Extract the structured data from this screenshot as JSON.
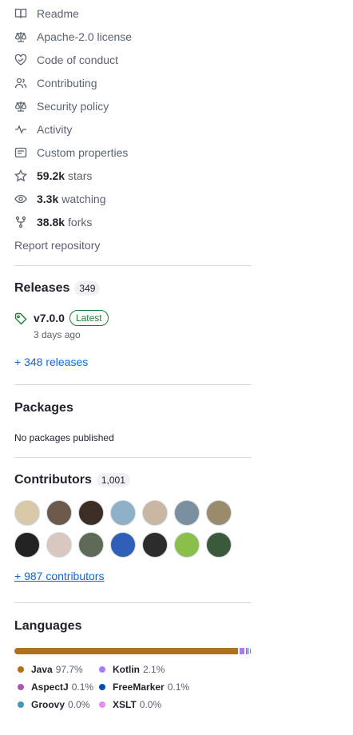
{
  "about_links": [
    {
      "name": "readme",
      "icon": "book-icon",
      "label": "Readme"
    },
    {
      "name": "license",
      "icon": "law-icon",
      "label": "Apache-2.0 license"
    },
    {
      "name": "code-of-conduct",
      "icon": "code-of-conduct-icon",
      "label": "Code of conduct"
    },
    {
      "name": "contributing",
      "icon": "people-icon",
      "label": "Contributing"
    },
    {
      "name": "security-policy",
      "icon": "law-icon",
      "label": "Security policy"
    },
    {
      "name": "activity",
      "icon": "pulse-icon",
      "label": "Activity"
    },
    {
      "name": "custom-properties",
      "icon": "note-icon",
      "label": "Custom properties"
    },
    {
      "name": "stars",
      "icon": "star-icon",
      "count": "59.2k",
      "label": "stars"
    },
    {
      "name": "watching",
      "icon": "eye-icon",
      "count": "3.3k",
      "label": "watching"
    },
    {
      "name": "forks",
      "icon": "repo-forked-icon",
      "count": "38.8k",
      "label": "forks"
    }
  ],
  "report_repository": "Report repository",
  "releases": {
    "title": "Releases",
    "count": "349",
    "latest_tag": "v7.0.0",
    "latest_badge": "Latest",
    "latest_date": "3 days ago",
    "more_link": "+ 348 releases"
  },
  "packages": {
    "title": "Packages",
    "empty_text": "No packages published"
  },
  "contributors": {
    "title": "Contributors",
    "count": "1,001",
    "avatar_colors": [
      "#d9c9a8",
      "#6b5a4a",
      "#3d2e25",
      "#8fb0c9",
      "#c9b7a3",
      "#7a8f9f",
      "#9a8b6d",
      "#222222",
      "#d8c8c0",
      "#5e6a55",
      "#2f5fb8",
      "#2c2c2c",
      "#8ac04a",
      "#3a5a3a"
    ],
    "more_link": "+ 987 contributors"
  },
  "languages": {
    "title": "Languages",
    "items": [
      {
        "name": "Java",
        "percent": "97.7%",
        "value": 97.7,
        "color": "#b07219"
      },
      {
        "name": "Kotlin",
        "percent": "2.1%",
        "value": 2.1,
        "color": "#A97BFF"
      },
      {
        "name": "AspectJ",
        "percent": "0.1%",
        "value": 0.1,
        "color": "#a957b0"
      },
      {
        "name": "FreeMarker",
        "percent": "0.1%",
        "value": 0.1,
        "color": "#0050b2"
      },
      {
        "name": "Groovy",
        "percent": "0.0%",
        "value": 0.05,
        "color": "#4298b8"
      },
      {
        "name": "XSLT",
        "percent": "0.0%",
        "value": 0.05,
        "color": "#EB8CEB"
      }
    ]
  }
}
